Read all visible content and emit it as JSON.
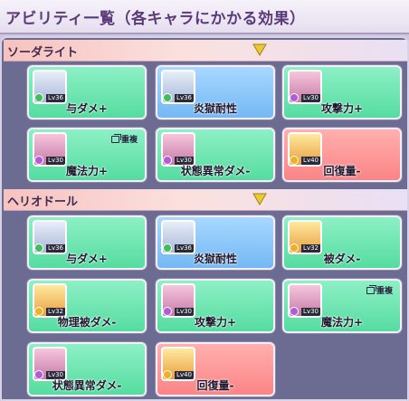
{
  "title": "アビリティ一覧（各キャラにかかる効果）",
  "sections": [
    {
      "name": "ソーダライト",
      "cards": [
        {
          "label": "与ダメ+",
          "lv": "Lv36",
          "dup": ""
        },
        {
          "label": "炎獄耐性",
          "lv": "Lv36",
          "dup": ""
        },
        {
          "label": "攻撃力+",
          "lv": "Lv30",
          "dup": ""
        },
        {
          "label": "魔法力+",
          "lv": "Lv30",
          "dup": "重複"
        },
        {
          "label": "状態異常ダメ-",
          "lv": "Lv30",
          "dup": ""
        },
        {
          "label": "回復量-",
          "lv": "Lv40",
          "dup": ""
        }
      ]
    },
    {
      "name": "ヘリオドール",
      "cards": [
        {
          "label": "与ダメ+",
          "lv": "Lv36",
          "dup": ""
        },
        {
          "label": "炎獄耐性",
          "lv": "Lv36",
          "dup": ""
        },
        {
          "label": "被ダメ-",
          "lv": "Lv32",
          "dup": ""
        },
        {
          "label": "物理被ダメ-",
          "lv": "Lv32",
          "dup": ""
        },
        {
          "label": "攻撃力+",
          "lv": "Lv30",
          "dup": ""
        },
        {
          "label": "魔法力+",
          "lv": "Lv30",
          "dup": "重複"
        },
        {
          "label": "状態異常ダメ-",
          "lv": "Lv30",
          "dup": ""
        },
        {
          "label": "回復量-",
          "lv": "Lv40",
          "dup": ""
        }
      ]
    }
  ],
  "colors": {
    "green_card": "#55dca0",
    "blue_card": "#74b8f4",
    "red_card": "#fb8486",
    "panel": "#6c6b92",
    "arrow": "#e7c93a"
  },
  "icons": {
    "collapse": "triangle-down-icon",
    "duplicate": "duplicate-icon"
  }
}
